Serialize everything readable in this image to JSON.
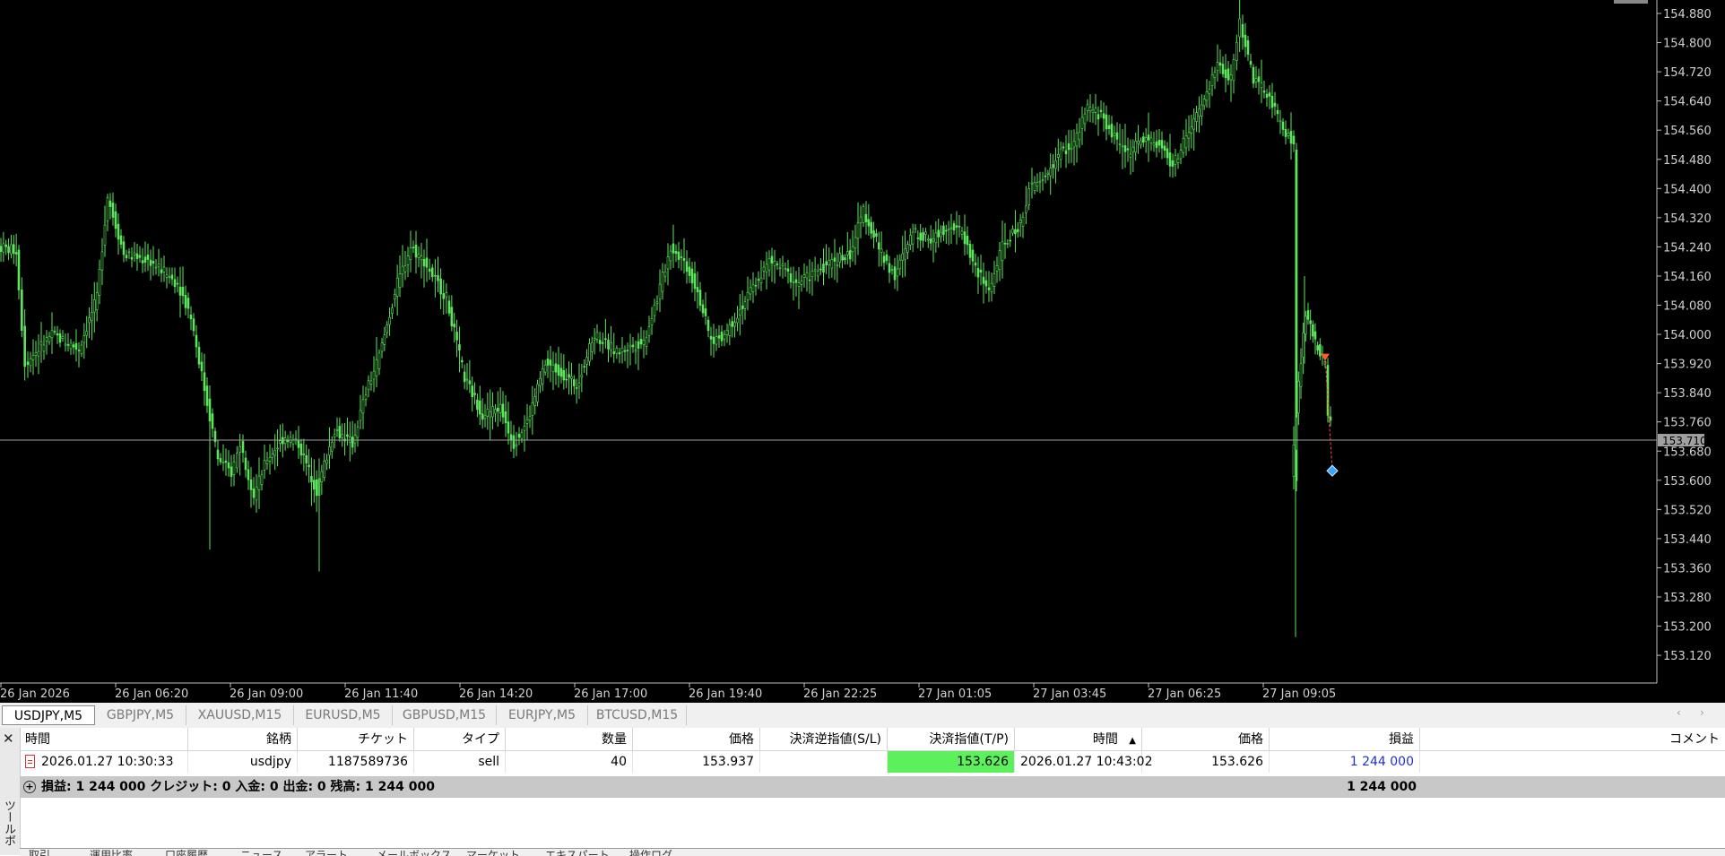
{
  "chart": {
    "background": "#000000",
    "candle_color": "#5ce65c",
    "current_price_label": "153.710",
    "y_axis_labels": [
      "154.880",
      "154.800",
      "154.720",
      "154.640",
      "154.560",
      "154.480",
      "154.400",
      "154.320",
      "154.240",
      "154.160",
      "154.080",
      "154.000",
      "153.920",
      "153.840",
      "153.760",
      "153.680",
      "153.600",
      "153.520",
      "153.440",
      "153.360",
      "153.280",
      "153.200",
      "153.120"
    ],
    "x_axis_labels": [
      "26 Jan 2026",
      "26 Jan 06:20",
      "26 Jan 09:00",
      "26 Jan 11:40",
      "26 Jan 14:20",
      "26 Jan 17:00",
      "26 Jan 19:40",
      "26 Jan 22:25",
      "27 Jan 01:05",
      "27 Jan 03:45",
      "27 Jan 06:25",
      "27 Jan 09:05"
    ]
  },
  "symbol_tabs": [
    "USDJPY,M5",
    "GBPJPY,M5",
    "XAUUSD,M15",
    "EURUSD,M5",
    "GBPUSD,M15",
    "EURJPY,M5",
    "BTCUSD,M15"
  ],
  "history": {
    "side_label": "ツールボックス",
    "columns": {
      "open_time": "時間",
      "symbol": "銘柄",
      "ticket": "チケット",
      "type": "タイプ",
      "volume": "数量",
      "open_price": "価格",
      "sl": "決済逆指値(S/L)",
      "tp": "決済指値(T/P)",
      "close_time": "時間",
      "close_price": "価格",
      "profit": "損益",
      "comment": "コメント"
    },
    "row": {
      "open_time": "2026.01.27 10:30:33",
      "symbol": "usdjpy",
      "ticket": "1187589736",
      "type": "sell",
      "volume": "40",
      "open_price": "153.937",
      "sl": "",
      "tp": "153.626",
      "close_time": "2026.01.27 10:43:02",
      "close_price": "153.626",
      "profit": "1 244 000",
      "comment": ""
    },
    "summary": "損益: 1 244 000  クレジット: 0  入金: 0  出金: 0  残高: 1 244 000",
    "summary_total": "1 244 000"
  },
  "bottom_tabs": [
    "取引",
    "運用比率",
    "口座履歴",
    "ニュース",
    "アラート",
    "メールボックス",
    "マーケット",
    "エキスパート",
    "操作ログ"
  ]
}
